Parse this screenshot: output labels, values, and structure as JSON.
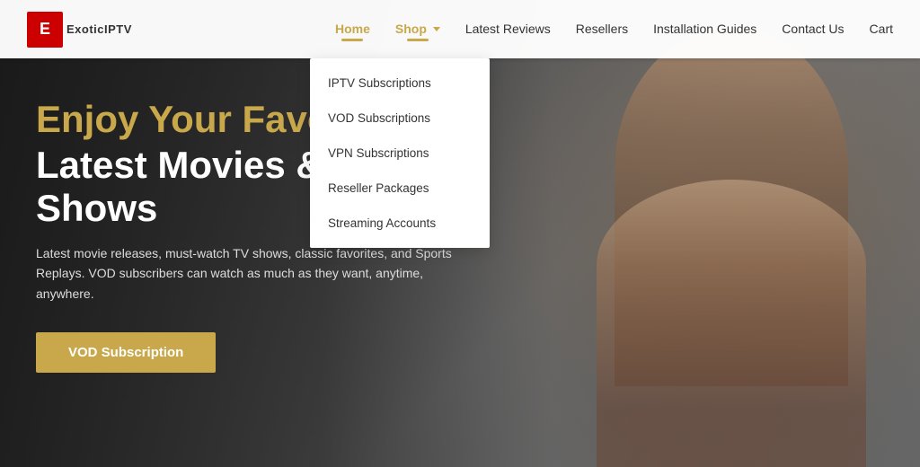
{
  "logo": {
    "icon_letter": "E",
    "text": "ExoticIPTV"
  },
  "navbar": {
    "links": [
      {
        "label": "Home",
        "active": true,
        "has_indicator": true
      },
      {
        "label": "Shop",
        "active": true,
        "has_arrow": true,
        "has_indicator": true
      },
      {
        "label": "Latest Reviews"
      },
      {
        "label": "Resellers"
      },
      {
        "label": "Installation Guides"
      },
      {
        "label": "Contact Us"
      },
      {
        "label": "Cart"
      }
    ]
  },
  "dropdown": {
    "items": [
      "IPTV Subscriptions",
      "VOD Subscriptions",
      "VPN Subscriptions",
      "Reseller Packages",
      "Streaming Accounts"
    ]
  },
  "hero": {
    "enjoy_line": "Enjoy Your Favo",
    "title_line": "Latest Movies & TV-Shows",
    "description": "Latest movie releases, must-watch TV shows, classic favorites, and Sports Replays. VOD subscribers can watch as much as they want, anytime, anywhere.",
    "cta_button": "VOD Subscription"
  }
}
